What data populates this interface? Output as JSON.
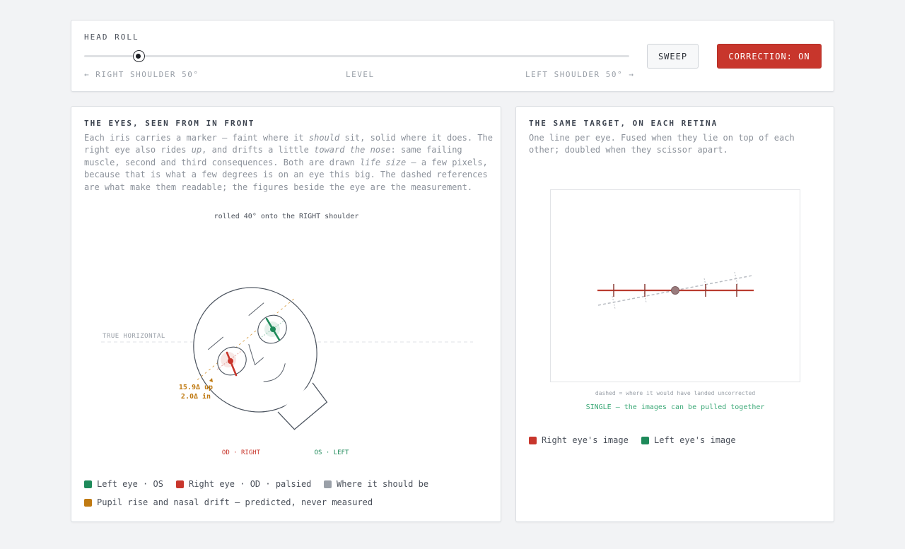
{
  "controls": {
    "label": "HEAD ROLL",
    "slider_value_deg": -40,
    "slider_min_deg": -50,
    "slider_max_deg": 50,
    "scale_left": "← RIGHT SHOULDER 50°",
    "scale_mid": "LEVEL",
    "scale_right": "LEFT SHOULDER 50° →",
    "sweep_label": "SWEEP",
    "correction_label": "CORRECTION: ON"
  },
  "eyes_panel": {
    "title": "THE EYES, SEEN FROM IN FRONT",
    "desc": {
      "p1": "Each iris carries a marker — faint where it ",
      "e1": "should",
      "p2": " sit, solid where it does. The right eye also rides ",
      "e2": "up",
      "p3": ", and drifts a little ",
      "e3": "toward the nose",
      "p4": ": same failing muscle, second and third consequences. Both are drawn ",
      "e4": "life size",
      "p5": " — a few pixels, because that is what a few degrees is on an eye this big. The dashed references are what make them readable; the figures beside the eye are the measurement."
    },
    "fig_caption": "rolled 40° onto the RIGHT shoulder",
    "true_horizontal": "TRUE HORIZONTAL",
    "measure_up": "15.9Δ up",
    "measure_in": "2.0Δ in",
    "label_od": "OD · RIGHT",
    "label_os": "OS · LEFT",
    "legend": {
      "left_eye": "Left eye · OS",
      "right_eye": "Right eye · OD · palsied",
      "should_be": "Where it should be",
      "predicted": "Pupil rise and nasal drift — predicted, never measured"
    }
  },
  "retina_panel": {
    "title": "THE SAME TARGET, ON EACH RETINA",
    "desc": "One line per eye. Fused when they lie on top of each other; doubled when they scissor apart.",
    "note": "dashed = where it would have landed uncorrected",
    "status": "SINGLE — the images can be pulled together",
    "legend": {
      "right_image": "Right eye's image",
      "left_image": "Left eye's image"
    }
  },
  "colors": {
    "left_eye": "#1e8a5a",
    "right_eye": "#c8362c",
    "reference": "#9aa0a8",
    "predicted": "#c07a12",
    "status_ok": "#3aa876",
    "correction_on": "#c8362c"
  }
}
